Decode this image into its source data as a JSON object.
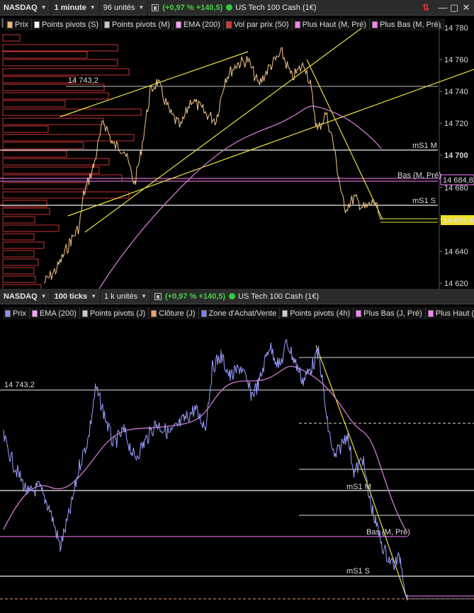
{
  "panel1": {
    "toolbar": {
      "symbol": "NASDAQ",
      "interval": "1 minute",
      "units": "96 unités",
      "change": "(+0,97 % +140,5)",
      "instrument": "US Tech 100 Cash (1€)"
    },
    "legend": [
      {
        "label": "Prix",
        "color": "#f5b26a"
      },
      {
        "label": "Points pivots (S)",
        "color": "#ffffff"
      },
      {
        "label": "Points pivots (M)",
        "color": "#cccccc"
      },
      {
        "label": "EMA (200)",
        "color": "#ff9eff"
      },
      {
        "label": "Vol par prix (50)",
        "color": "#e03030"
      },
      {
        "label": "Plus Haut (M, Pré)",
        "color": "#ff80ff"
      },
      {
        "label": "Plus Bas (M, Pré)",
        "color": "#ff80ff"
      }
    ],
    "axis_ticks": [
      "14 780",
      "14 760",
      "14 740",
      "14 720",
      "14 700",
      "14 680",
      "14 660",
      "14 640",
      "14 620"
    ],
    "labels": {
      "level_left": "14 743,2",
      "ms1m": "mS1 M",
      "ms1s": "mS1 S",
      "bas": "Bas (M, Pré)",
      "badge_pink": "14 684,8",
      "badge_yellow": "14 659,9"
    }
  },
  "panel2": {
    "toolbar": {
      "symbol": "NASDAQ",
      "interval": "100 ticks",
      "units": "1 k unités",
      "change": "(+0,97 % +140,5)",
      "instrument": "US Tech 100 Cash (1€)"
    },
    "legend": [
      {
        "label": "Prix",
        "color": "#8f8fff"
      },
      {
        "label": "EMA (200)",
        "color": "#ff9eff"
      },
      {
        "label": "Points pivots (J)",
        "color": "#cccccc"
      },
      {
        "label": "Clôture (J)",
        "color": "#f0a060"
      },
      {
        "label": "Zone d'Achat/Vente",
        "color": "#8080ff"
      },
      {
        "label": "Points pivots (4h)",
        "color": "#cccccc"
      },
      {
        "label": "Plus Bas (J, Pré)",
        "color": "#ff80ff"
      },
      {
        "label": "Plus Haut (",
        "color": "#ff80ff"
      }
    ],
    "labels": {
      "level_left": "14 743,2",
      "ms1m": "mS1 M",
      "ms1s": "mS1 S",
      "bas": "Bas (M, Pré)"
    }
  },
  "colors": {
    "price1": "#f5c88a",
    "price2": "#9aa0ff",
    "ema": "#d078d0",
    "trend": "#e8e040",
    "volume": "#c83232",
    "pivot": "#dddddd",
    "pink": "#ff80ff"
  }
}
